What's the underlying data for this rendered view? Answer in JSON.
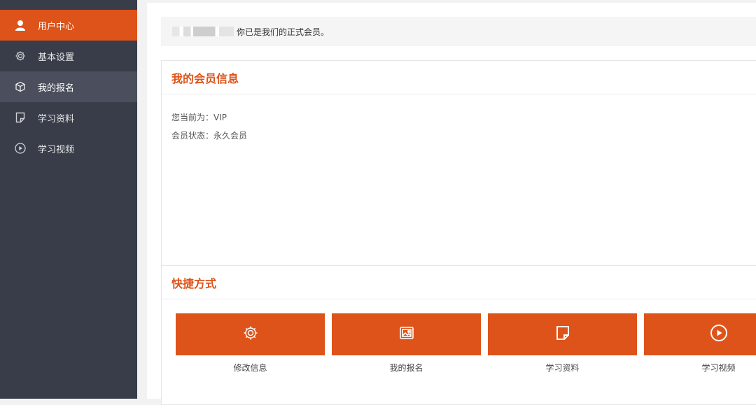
{
  "sidebar": {
    "items": [
      {
        "label": "用户中心",
        "icon": "user-icon",
        "state": "active"
      },
      {
        "label": "基本设置",
        "icon": "gear-icon",
        "state": "normal"
      },
      {
        "label": "我的报名",
        "icon": "cube-icon",
        "state": "hover"
      },
      {
        "label": "学习资料",
        "icon": "document-icon",
        "state": "normal"
      },
      {
        "label": "学习视频",
        "icon": "play-circle-icon",
        "state": "normal"
      }
    ]
  },
  "notice": {
    "message": "你已是我们的正式会员。"
  },
  "membership": {
    "title": "我的会员信息",
    "current_label": "您当前为：",
    "current_value": "VIP",
    "status_label": "会员状态：",
    "status_value": "永久会员"
  },
  "shortcuts": {
    "title": "快捷方式",
    "items": [
      {
        "label": "修改信息",
        "icon": "gear-icon"
      },
      {
        "label": "我的报名",
        "icon": "image-icon"
      },
      {
        "label": "学习资料",
        "icon": "document-icon"
      },
      {
        "label": "学习视频",
        "icon": "play-circle-icon"
      }
    ]
  },
  "colors": {
    "accent": "#de5319",
    "sidebar_bg": "#393d49",
    "sidebar_hover": "#4a4e5d"
  }
}
